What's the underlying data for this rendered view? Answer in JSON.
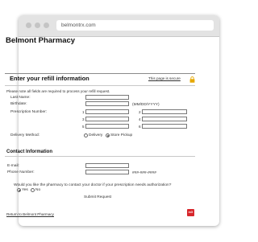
{
  "browser": {
    "url": "belmontrx.com"
  },
  "header": {
    "title": "Belmont Pharmacy"
  },
  "refill": {
    "heading": "Enter your refill information",
    "secure_link": "This page is secure",
    "note": "Please note all fields are required to process your refill request.",
    "last_name_label": "Last Name:",
    "birthdate_label": "Birthdate:",
    "birthdate_format": "(MM/DD/YYYY)",
    "prescription_label": "Prescription Number:",
    "rx_numbers": [
      "1",
      "2",
      "3",
      "4",
      "5",
      "6"
    ],
    "delivery_label": "Delivery Method:",
    "delivery_options": [
      {
        "label": "Delivery",
        "selected": false
      },
      {
        "label": "Store Pickup",
        "selected": true
      }
    ]
  },
  "contact": {
    "heading": "Contact Information",
    "email_label": "E-mail:",
    "phone_label": "Phone Number:",
    "phone_format": "###-###-####",
    "question": "Would you like the pharmacy to contact your doctor if your prescription needs authorization?",
    "answers": [
      {
        "label": "Yes",
        "selected": true
      },
      {
        "label": "No",
        "selected": false
      }
    ]
  },
  "actions": {
    "submit_label": "Submit Request"
  },
  "footer": {
    "return_link": "Return to Belmont Pharmacy",
    "logo_text": "rxX"
  },
  "colors": {
    "brand_red": "#d7262b",
    "lock_gold": "#e6a800"
  }
}
